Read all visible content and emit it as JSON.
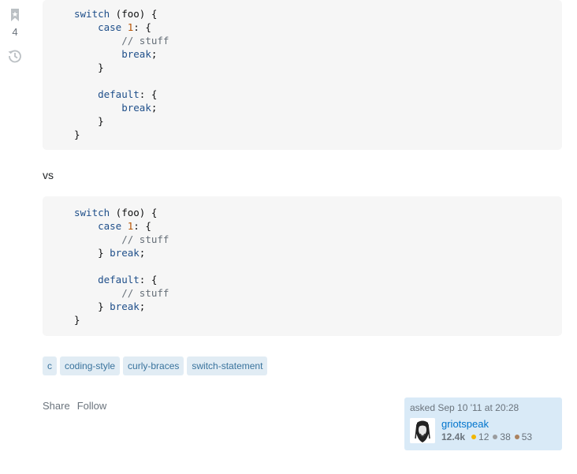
{
  "sidebar": {
    "bookmark_count": "4"
  },
  "code_blocks": [
    {
      "lines": [
        [
          {
            "t": "switch",
            "c": "kw"
          },
          {
            "t": " (foo) {",
            "c": ""
          }
        ],
        [
          {
            "t": "    ",
            "c": ""
          },
          {
            "t": "case",
            "c": "kw"
          },
          {
            "t": " ",
            "c": ""
          },
          {
            "t": "1",
            "c": "num"
          },
          {
            "t": ": {",
            "c": ""
          }
        ],
        [
          {
            "t": "        ",
            "c": ""
          },
          {
            "t": "// stuff",
            "c": "cm"
          }
        ],
        [
          {
            "t": "        ",
            "c": ""
          },
          {
            "t": "break",
            "c": "kw"
          },
          {
            "t": ";",
            "c": ""
          }
        ],
        [
          {
            "t": "    }",
            "c": ""
          }
        ],
        [],
        [
          {
            "t": "    ",
            "c": ""
          },
          {
            "t": "default",
            "c": "kw"
          },
          {
            "t": ": {",
            "c": ""
          }
        ],
        [
          {
            "t": "        ",
            "c": ""
          },
          {
            "t": "break",
            "c": "kw"
          },
          {
            "t": ";",
            "c": ""
          }
        ],
        [
          {
            "t": "    }",
            "c": ""
          }
        ],
        [
          {
            "t": "}",
            "c": ""
          }
        ]
      ]
    },
    {
      "lines": [
        [
          {
            "t": "switch",
            "c": "kw"
          },
          {
            "t": " (foo) {",
            "c": ""
          }
        ],
        [
          {
            "t": "    ",
            "c": ""
          },
          {
            "t": "case",
            "c": "kw"
          },
          {
            "t": " ",
            "c": ""
          },
          {
            "t": "1",
            "c": "num"
          },
          {
            "t": ": {",
            "c": ""
          }
        ],
        [
          {
            "t": "        ",
            "c": ""
          },
          {
            "t": "// stuff",
            "c": "cm"
          }
        ],
        [
          {
            "t": "    } ",
            "c": ""
          },
          {
            "t": "break",
            "c": "kw"
          },
          {
            "t": ";",
            "c": ""
          }
        ],
        [],
        [
          {
            "t": "    ",
            "c": ""
          },
          {
            "t": "default",
            "c": "kw"
          },
          {
            "t": ": {",
            "c": ""
          }
        ],
        [
          {
            "t": "        ",
            "c": ""
          },
          {
            "t": "// stuff",
            "c": "cm"
          }
        ],
        [
          {
            "t": "    } ",
            "c": ""
          },
          {
            "t": "break",
            "c": "kw"
          },
          {
            "t": ";",
            "c": ""
          }
        ],
        [
          {
            "t": "}",
            "c": ""
          }
        ]
      ]
    }
  ],
  "separator_text": "vs",
  "tags": [
    "c",
    "coding-style",
    "curly-braces",
    "switch-statement"
  ],
  "actions": {
    "share": "Share",
    "follow": "Follow"
  },
  "user_card": {
    "asked": "asked Sep 10 '11 at 20:28",
    "username": "griotspeak",
    "reputation": "12.4k",
    "gold": "12",
    "silver": "38",
    "bronze": "53"
  },
  "colors": {
    "keyword": "#1f4f8a",
    "number": "#b75301",
    "comment": "#656e77",
    "tag_bg": "#e1ecf4",
    "tag_text": "#39739d",
    "card_bg": "#d9eaf7",
    "link": "#0074cc"
  }
}
